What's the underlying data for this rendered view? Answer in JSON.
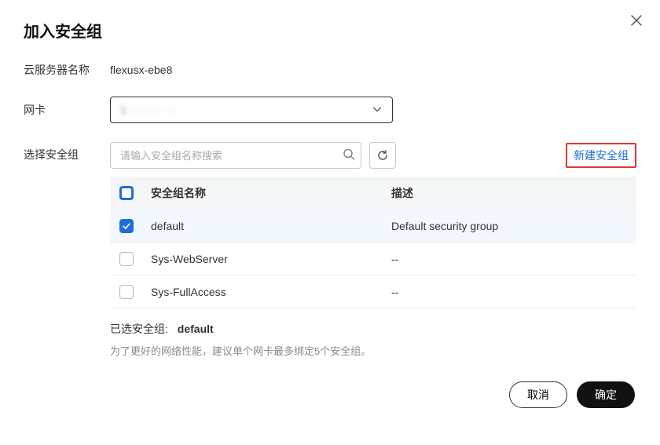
{
  "dialog": {
    "title": "加入安全组",
    "close_aria": "关闭"
  },
  "fields": {
    "server_name_label": "云服务器名称",
    "server_name_value": "flexusx-ebe8",
    "nic_label": "网卡",
    "nic_selected_masked": "1········ ··",
    "sg_label": "选择安全组",
    "search_placeholder": "请输入安全组名称搜索",
    "new_sg_link": "新建安全组"
  },
  "table": {
    "header_name": "安全组名称",
    "header_desc": "描述",
    "header_check_state": "indeterminate",
    "rows": [
      {
        "name": "default",
        "desc": "Default security group",
        "checked": true
      },
      {
        "name": "Sys-WebServer",
        "desc": "--",
        "checked": false
      },
      {
        "name": "Sys-FullAccess",
        "desc": "--",
        "checked": false
      }
    ]
  },
  "summary": {
    "selected_label": "已选安全组:",
    "selected_value": "default",
    "hint": "为了更好的网络性能，建议单个网卡最多绑定5个安全组。"
  },
  "footer": {
    "cancel": "取消",
    "confirm": "确定"
  }
}
